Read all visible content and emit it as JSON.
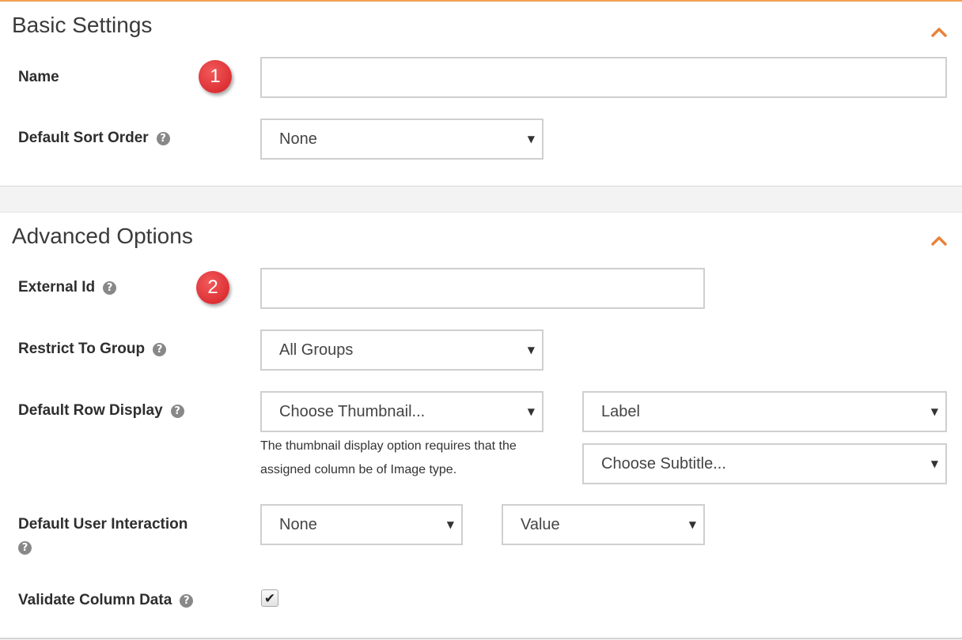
{
  "basic_settings": {
    "title": "Basic Settings",
    "name_label": "Name",
    "name_value": "",
    "marker_1": "1",
    "sort_order_label": "Default Sort Order",
    "sort_order_value": "None"
  },
  "advanced_options": {
    "title": "Advanced Options",
    "external_id_label": "External Id",
    "external_id_value": "",
    "marker_2": "2",
    "restrict_group_label": "Restrict To Group",
    "restrict_group_value": "All Groups",
    "row_display_label": "Default Row Display",
    "thumbnail_value": "Choose Thumbnail...",
    "thumbnail_help": "The thumbnail display option requires that the assigned column be of Image type.",
    "label_value": "Label",
    "subtitle_value": "Choose Subtitle...",
    "user_interaction_label": "Default User Interaction",
    "interaction_value": "None",
    "interaction_target_value": "Value",
    "validate_label": "Validate Column Data",
    "validate_checked": true
  },
  "icons": {
    "help": "question-circle-icon",
    "collapse": "chevron-up-icon",
    "dropdown": "caret-down-icon",
    "check": "checkmark-icon"
  },
  "colors": {
    "accent_orange": "#f0a050",
    "chevron_orange": "#e8823a",
    "badge_red": "#d41f25"
  }
}
